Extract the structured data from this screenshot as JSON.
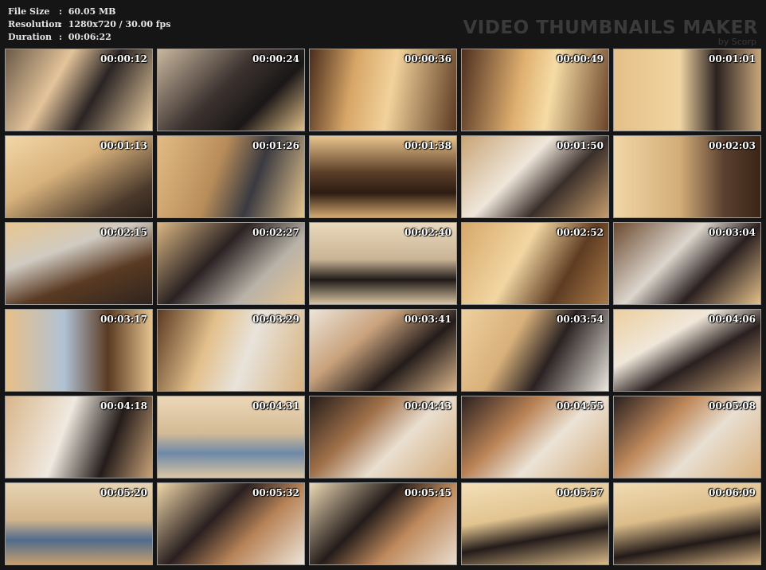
{
  "info": {
    "file_size_label": "File Size",
    "file_size_value": ":  60.05 MB",
    "resolution_label": "Resolution",
    "resolution_value": ":  1280x720 / 30.00 fps",
    "duration_label": "Duration",
    "duration_value": ":  00:06:22"
  },
  "brand": {
    "title": "VIDEO THUMBNAILS MAKER",
    "byline": "by Scorp"
  },
  "thumbnails": [
    {
      "time": "00:00:12",
      "bg": "linear-gradient(120deg,#6b5a48 0%,#e4c49a 35%,#2a2424 60%,#f0d2a4 100%)"
    },
    {
      "time": "00:00:24",
      "bg": "linear-gradient(135deg,#c9b79f 0%,#3d3330 45%,#1a1717 70%,#e1bf8a 100%)"
    },
    {
      "time": "00:00:36",
      "bg": "linear-gradient(100deg,#4a2d1c 0%,#d7a667 30%,#f2d29b 55%,#5b3a22 100%)"
    },
    {
      "time": "00:00:49",
      "bg": "linear-gradient(100deg,#4e3020 0%,#e0b070 40%,#f5dca5 60%,#6a4328 100%)"
    },
    {
      "time": "00:01:01",
      "bg": "linear-gradient(90deg,#e5c088 0%,#f0d5a2 45%,#2b2220 70%,#c7a57a 100%)"
    },
    {
      "time": "00:01:13",
      "bg": "linear-gradient(150deg,#f3d7a8 0%,#d8b27c 40%,#4b3a2c 80%,#2a2018 100%)"
    },
    {
      "time": "00:01:26",
      "bg": "linear-gradient(110deg,#e2bb84 0%,#b98d5a 40%,#3a3a40 65%,#e7c58f 100%)"
    },
    {
      "time": "00:01:38",
      "bg": "linear-gradient(180deg,#e9c48c 0%,#5a3d27 45%,#2d1c12 70%,#d2a870 100%)"
    },
    {
      "time": "00:01:50",
      "bg": "linear-gradient(135deg,#c8a576 0%,#efe6da 40%,#3a2f2a 65%,#c59b6a 100%)"
    },
    {
      "time": "00:02:03",
      "bg": "linear-gradient(90deg,#f1d6a6 0%,#d3ad78 45%,#5a4030 75%,#3a2516 100%)"
    },
    {
      "time": "00:02:15",
      "bg": "linear-gradient(160deg,#e8c690 0%,#d0cbc2 35%,#5a3a22 65%,#2e241e 100%)"
    },
    {
      "time": "00:02:27",
      "bg": "linear-gradient(135deg,#d9b683 0%,#2a2222 40%,#b9b2a8 70%,#e5c38e 100%)"
    },
    {
      "time": "00:02:40",
      "bg": "linear-gradient(180deg,#ead9bd 0%,#c9b394 45%,#1f1a18 70%,#d8c3a2 100%)"
    },
    {
      "time": "00:02:52",
      "bg": "linear-gradient(120deg,#d6a86a 0%,#f2d6a2 40%,#5e3c22 70%,#a97a48 100%)"
    },
    {
      "time": "00:03:04",
      "bg": "linear-gradient(135deg,#6b4a30 0%,#dcd6cd 40%,#2a2020 65%,#e4c08a 100%)"
    },
    {
      "time": "00:03:17",
      "bg": "linear-gradient(90deg,#e8c088 0%,#b0c2d4 40%,#5a3a22 70%,#e5c390 100%)"
    },
    {
      "time": "00:03:29",
      "bg": "linear-gradient(110deg,#5b3a22 0%,#e3c08c 35%,#e8e3db 60%,#d7b27e 100%)"
    },
    {
      "time": "00:03:41",
      "bg": "linear-gradient(140deg,#ece4d8 0%,#c9a27c 35%,#241c1a 65%,#d9b58a 100%)"
    },
    {
      "time": "00:03:54",
      "bg": "linear-gradient(120deg,#efd09e 0%,#d8b07a 35%,#2a2222 60%,#ece7df 100%)"
    },
    {
      "time": "00:04:06",
      "bg": "linear-gradient(150deg,#eccf9e 0%,#f0e7da 35%,#2a2020 60%,#c9a377 100%)"
    },
    {
      "time": "00:04:18",
      "bg": "linear-gradient(110deg,#d9b68a 0%,#efe9e0 40%,#241c1a 70%,#c9a278 100%)"
    },
    {
      "time": "00:04:31",
      "bg": "linear-gradient(180deg,#ebd7b8 0%,#d4bb95 45%,#6d89a8 70%,#dcc6a2 100%)"
    },
    {
      "time": "00:04:43",
      "bg": "linear-gradient(135deg,#241c1a 0%,#a1714a 35%,#eadfd0 60%,#d2a977 100%)"
    },
    {
      "time": "00:04:55",
      "bg": "linear-gradient(135deg,#2a2020 0%,#b98255 35%,#ece3d6 60%,#d2aa78 100%)"
    },
    {
      "time": "00:05:08",
      "bg": "linear-gradient(135deg,#2a2020 0%,#c08a5c 35%,#e8dfd2 60%,#d8b07c 100%)"
    },
    {
      "time": "00:05:20",
      "bg": "linear-gradient(180deg,#e7d3b2 0%,#d2b58b 45%,#4f6b8c 70%,#c89f6e 100%)"
    },
    {
      "time": "00:05:32",
      "bg": "linear-gradient(135deg,#efd6a8 0%,#2a2020 40%,#b88458 65%,#ece4d8 100%)"
    },
    {
      "time": "00:05:45",
      "bg": "linear-gradient(135deg,#ecd8b4 0%,#241c1a 40%,#bf8a5d 65%,#e7dccd 100%)"
    },
    {
      "time": "00:05:57",
      "bg": "linear-gradient(170deg,#f3dfb8 0%,#e2c490 40%,#241c1a 65%,#d9ba88 100%)"
    },
    {
      "time": "00:06:09",
      "bg": "linear-gradient(170deg,#f1dbb2 0%,#dcbd8a 40%,#221a18 70%,#d3b282 100%)"
    }
  ]
}
